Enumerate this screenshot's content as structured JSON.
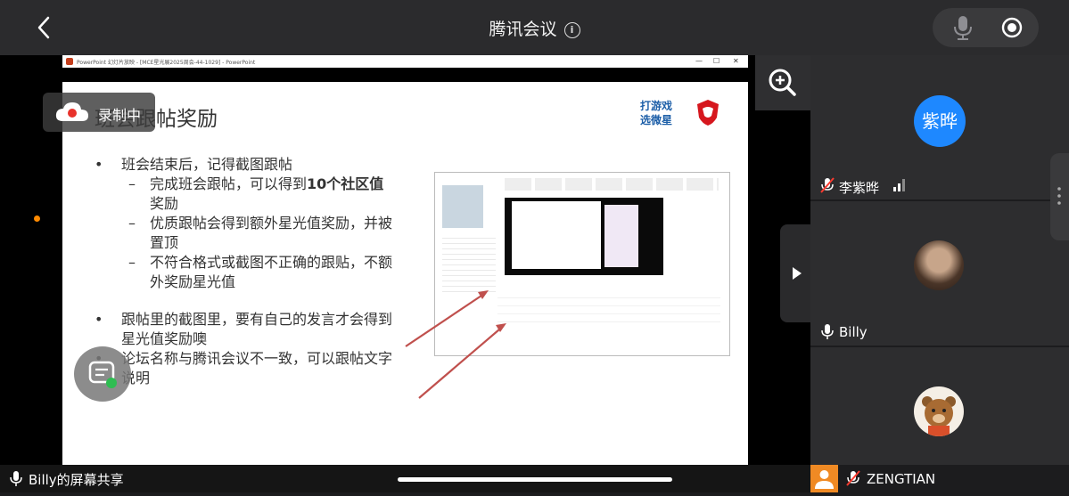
{
  "header": {
    "title": "腾讯会议"
  },
  "recording": {
    "label": "录制中"
  },
  "slide": {
    "window_title": "PowerPoint 幻灯片放映 - [MCE星光展2025周会-44-1029] - PowerPoint",
    "title": "班会跟帖奖励",
    "bullets": [
      {
        "text": "班会结束后，记得截图跟帖"
      },
      {
        "sub": "完成班会跟帖，可以得到",
        "bold": "10个社区值",
        "tail": "奖励"
      },
      {
        "sub": "优质跟帖会得到额外星光值奖励，并被置顶"
      },
      {
        "sub": "不符合格式或截图不正确的跟贴，不额外奖励星光值"
      },
      {
        "text": "跟帖里的截图里，要有自己的发言才会得到星光值奖励噢"
      },
      {
        "text": "论坛名称与腾讯会议不一致，可以跟帖文字说明"
      }
    ],
    "logo_text": [
      "打游戏",
      "选微星"
    ]
  },
  "participants": [
    {
      "name": "李紫晔",
      "avatar_text": "紫晔",
      "avatar_color": "#1e88ff",
      "muted": true
    },
    {
      "name": "Billy",
      "muted": false
    },
    {
      "name": "ZENGTIAN",
      "muted": true
    }
  ],
  "share": {
    "label": "Billy的屏幕共享"
  }
}
